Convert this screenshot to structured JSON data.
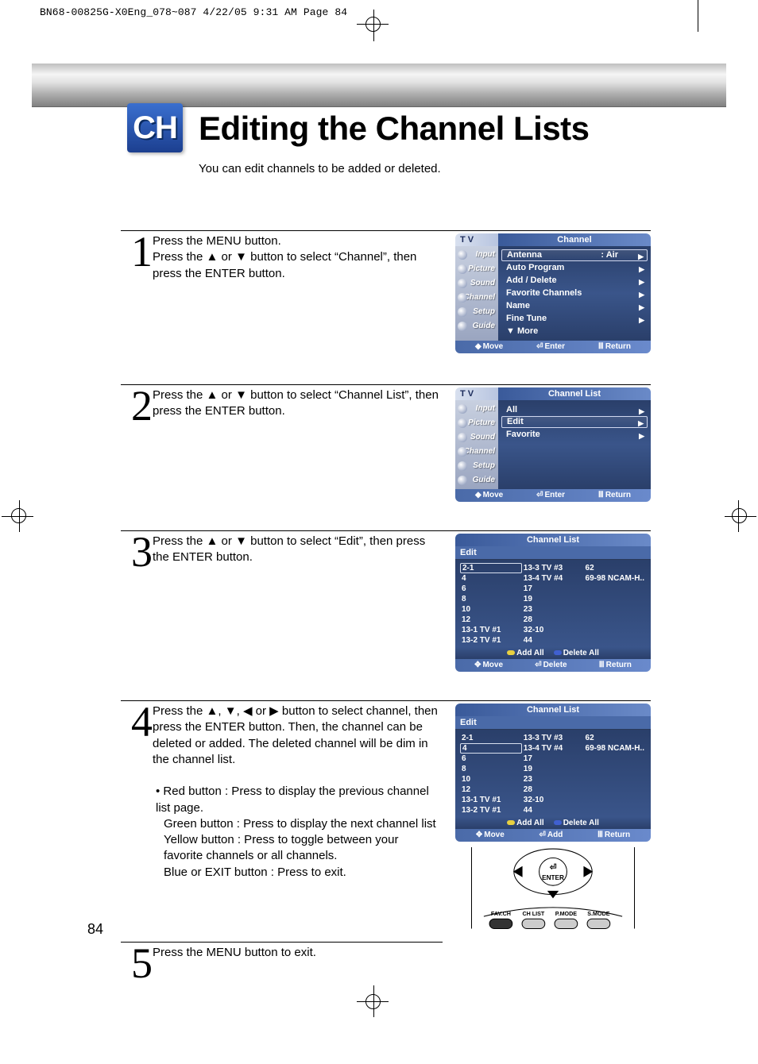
{
  "printmark": "BN68-00825G-X0Eng_078~087  4/22/05  9:31 AM  Page 84",
  "badge": "CH",
  "title": "Editing the Channel Lists",
  "subtitle": "You can edit channels to be added or deleted.",
  "steps": {
    "s1": {
      "num": "1",
      "line1": "Press the MENU button.",
      "line2a": "Press the ",
      "line2b": " or ",
      "line2c": " button to select “Channel”, then press the ENTER button."
    },
    "s2": {
      "num": "2",
      "line1a": "Press the ",
      "line1b": " or ",
      "line1c": " button to select “Channel List”, then press the ENTER button."
    },
    "s3": {
      "num": "3",
      "line1a": "Press the ",
      "line1b": " or ",
      "line1c": " button to select “Edit”, then press the ENTER button."
    },
    "s4": {
      "num": "4",
      "p1a": "Press the ",
      "p1b": ", ",
      "p1c": ", ",
      "p1d": " or ",
      "p1e": " button to select channel, then press the ENTER button. Then, the channel can be deleted or added. The deleted channel will be dim in the channel list.",
      "b1": "• Red button : Press to display the previous channel list page.",
      "b2": "Green button : Press to display the next channel list",
      "b3": "Yellow button : Press to toggle between your favorite channels or all channels.",
      "b4": "Blue or EXIT button : Press to exit."
    },
    "s5": {
      "num": "5",
      "line1": "Press the MENU button to exit."
    }
  },
  "osd": {
    "side_tabs": [
      "Input",
      "Picture",
      "Sound",
      "Channel",
      "Setup",
      "Guide"
    ],
    "foot_move": "Move",
    "foot_enter": "Enter",
    "foot_return": "Return",
    "foot_delete": "Delete",
    "foot_add": "Add",
    "panel1": {
      "hl": "T V",
      "hr": "Channel",
      "rows": [
        {
          "label": "Antenna",
          "value": ": Air",
          "sel": true,
          "arr": true
        },
        {
          "label": "Auto Program",
          "arr": true
        },
        {
          "label": "Add / Delete",
          "arr": true
        },
        {
          "label": "Favorite Channels",
          "arr": true
        },
        {
          "label": "Name",
          "arr": true
        },
        {
          "label": "Fine Tune",
          "arr": true
        },
        {
          "label": "▼ More"
        }
      ]
    },
    "panel2": {
      "hl": "T V",
      "hr": "Channel List",
      "rows": [
        {
          "label": "All",
          "arr": true
        },
        {
          "label": "Edit",
          "sel": true,
          "arr": true
        },
        {
          "label": "Favorite",
          "arr": true
        }
      ]
    },
    "panel3": {
      "hr": "Channel List",
      "tab": "Edit",
      "col1": [
        "2-1",
        "4",
        "6",
        "8",
        "10",
        "12",
        "13-1 TV #1",
        "13-2 TV #1"
      ],
      "col1_sel": 0,
      "col2": [
        "13-3 TV #3",
        "13-4 TV #4",
        "17",
        "19",
        "23",
        "28",
        "32-10",
        "44"
      ],
      "col3": [
        "62",
        "69-98 NCAM-H.."
      ],
      "opt1": "Add All",
      "opt2": "Delete All"
    },
    "panel4": {
      "hr": "Channel List",
      "tab": "Edit",
      "col1": [
        "2-1",
        "4",
        "6",
        "8",
        "10",
        "12",
        "13-1 TV #1",
        "13-2 TV #1"
      ],
      "col1_sel": 1,
      "col2": [
        "13-3 TV #3",
        "13-4 TV #4",
        "17",
        "19",
        "23",
        "28",
        "32-10",
        "44"
      ],
      "col3": [
        "62",
        "69-98 NCAM-H.."
      ],
      "opt1": "Add All",
      "opt2": "Delete All"
    }
  },
  "remote": {
    "enter": "ENTER",
    "b1": "FAV.CH",
    "b2": "CH LIST",
    "b3": "P.MODE",
    "b4": "S.MODE"
  },
  "glyphs": {
    "up": "▲",
    "down": "▼",
    "left": "◀",
    "right": "▶",
    "updown": "◆",
    "enter": "⏎",
    "menu": "Ⅲ"
  },
  "page_number": "84"
}
